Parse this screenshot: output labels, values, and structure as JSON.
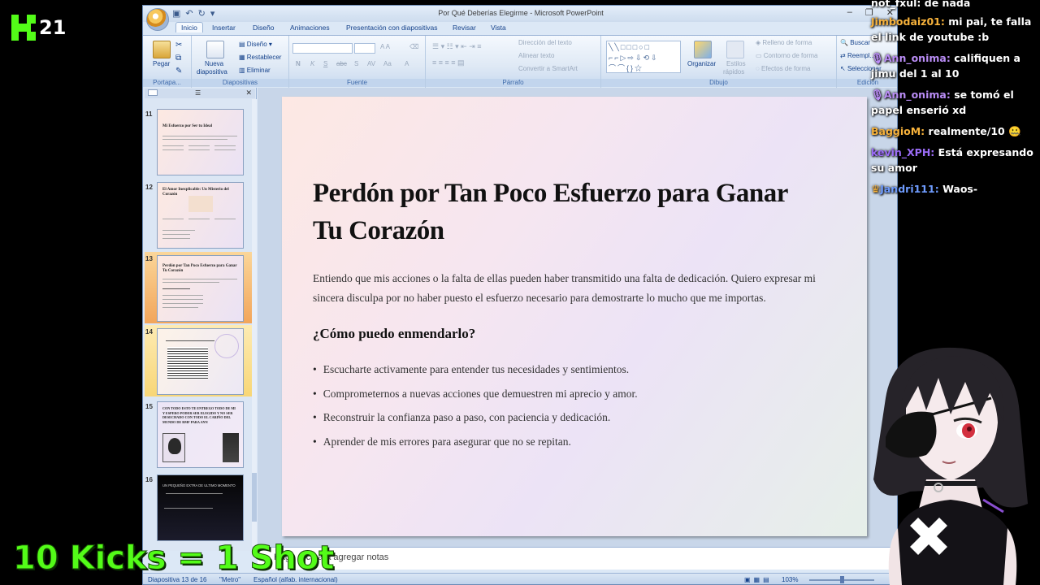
{
  "overlay": {
    "kick_count": "21",
    "kicks_text": "10 Kicks = 1 Shot",
    "brand_color": "#53fc18"
  },
  "window": {
    "title": "Por Qué Deberías Elegirme - Microsoft PowerPoint"
  },
  "tabs": [
    "Inicio",
    "Insertar",
    "Diseño",
    "Animaciones",
    "Presentación con diapositivas",
    "Revisar",
    "Vista"
  ],
  "ribbon": {
    "portapapeles": {
      "label": "Portapa...",
      "pegar": "Pegar"
    },
    "diapositivas": {
      "label": "Diapositivas",
      "nueva": "Nueva",
      "diapositiva": "diapositiva",
      "diseno": "Diseño",
      "restablecer": "Restablecer",
      "eliminar": "Eliminar"
    },
    "fuente": {
      "label": "Fuente",
      "buttons": [
        "N",
        "K",
        "S",
        "abc",
        "S",
        "AV",
        "Aa",
        "A"
      ]
    },
    "parrafo": {
      "label": "Párrafo",
      "direccion": "Dirección del texto",
      "alinear": "Alinear texto",
      "smartart": "Convertir a SmartArt"
    },
    "dibujo": {
      "label": "Dibujo",
      "organizar": "Organizar",
      "estilos": "Estilos",
      "rapidos": "rápidos",
      "relleno": "Relleno de forma",
      "contorno": "Contorno de forma",
      "efectos": "Efectos de forma"
    },
    "edicion": {
      "label": "Edición",
      "buscar": "Buscar",
      "reemplazar": "Reempl...",
      "seleccionar": "Seleccionar"
    }
  },
  "slides_pane": {
    "thumbnails": [
      {
        "num": "11",
        "title": "Mi Esfuerzo por Ser tu Ideal"
      },
      {
        "num": "12",
        "title": "El Amor Inexplicable: Un Misterio del Corazón"
      },
      {
        "num": "13",
        "title": "Perdón por Tan Poco Esfuerzo para Ganar Tu Corazón"
      },
      {
        "num": "14",
        "title": ""
      },
      {
        "num": "15",
        "title": "CON TODO ESTO TE ENTREGO TODO DE MI Y ESPERO PODER SER ELEGIDO Y NO SER DESECHADO CON TODO EL CARIÑO DEL MUNDO DE RMF PARA ANN"
      },
      {
        "num": "16",
        "title": "UN PEQUEÑO EXTRA DE ULTIMO MOMENTO"
      }
    ]
  },
  "slide": {
    "title": "Perdón por Tan Poco Esfuerzo para Ganar Tu Corazón",
    "body": "Entiendo que mis acciones o la falta de ellas pueden haber transmitido una falta de dedicación. Quiero expresar mi sincera disculpa por no haber puesto el esfuerzo necesario para demostrarte lo mucho que me importas.",
    "subtitle": "¿Cómo puedo enmendarlo?",
    "bullets": [
      "Escucharte activamente para entender tus necesidades y sentimientos.",
      "Comprometernos a nuevas acciones que demuestren mi aprecio y amor.",
      "Reconstruir la confianza paso a paso, con paciencia y dedicación.",
      "Aprender de mis errores para asegurar que no se repitan."
    ]
  },
  "notes": {
    "placeholder": "Haga clic para agregar notas"
  },
  "status": {
    "slide_info": "Diapositiva 13 de 16",
    "theme": "\"Metro\"",
    "language": "Español (alfab. internacional)",
    "zoom": "103%"
  },
  "chat": [
    {
      "user": "not_fxul:",
      "msg": "de nada",
      "color": "#ffffff"
    },
    {
      "user": "Jimbodaiz01:",
      "msg": "mi pai, te falla el link de youtube :b",
      "color": "#f7b23b"
    },
    {
      "user": "Ann_onima:",
      "msg": "califiquen a jimu del 1 al 10",
      "color": "#b98cf5"
    },
    {
      "user": "Ann_onima:",
      "msg": "se tomó el papel enserió xd",
      "color": "#b98cf5"
    },
    {
      "user": "BaggioM:",
      "msg": "realmente/10 🤐",
      "color": "#f7b23b"
    },
    {
      "user": "kevin_XPH:",
      "msg": "Está expresando su amor",
      "color": "#9b6cf7"
    },
    {
      "user": "Jandri111:",
      "msg": "Waos-",
      "color": "#6f9cff"
    }
  ]
}
